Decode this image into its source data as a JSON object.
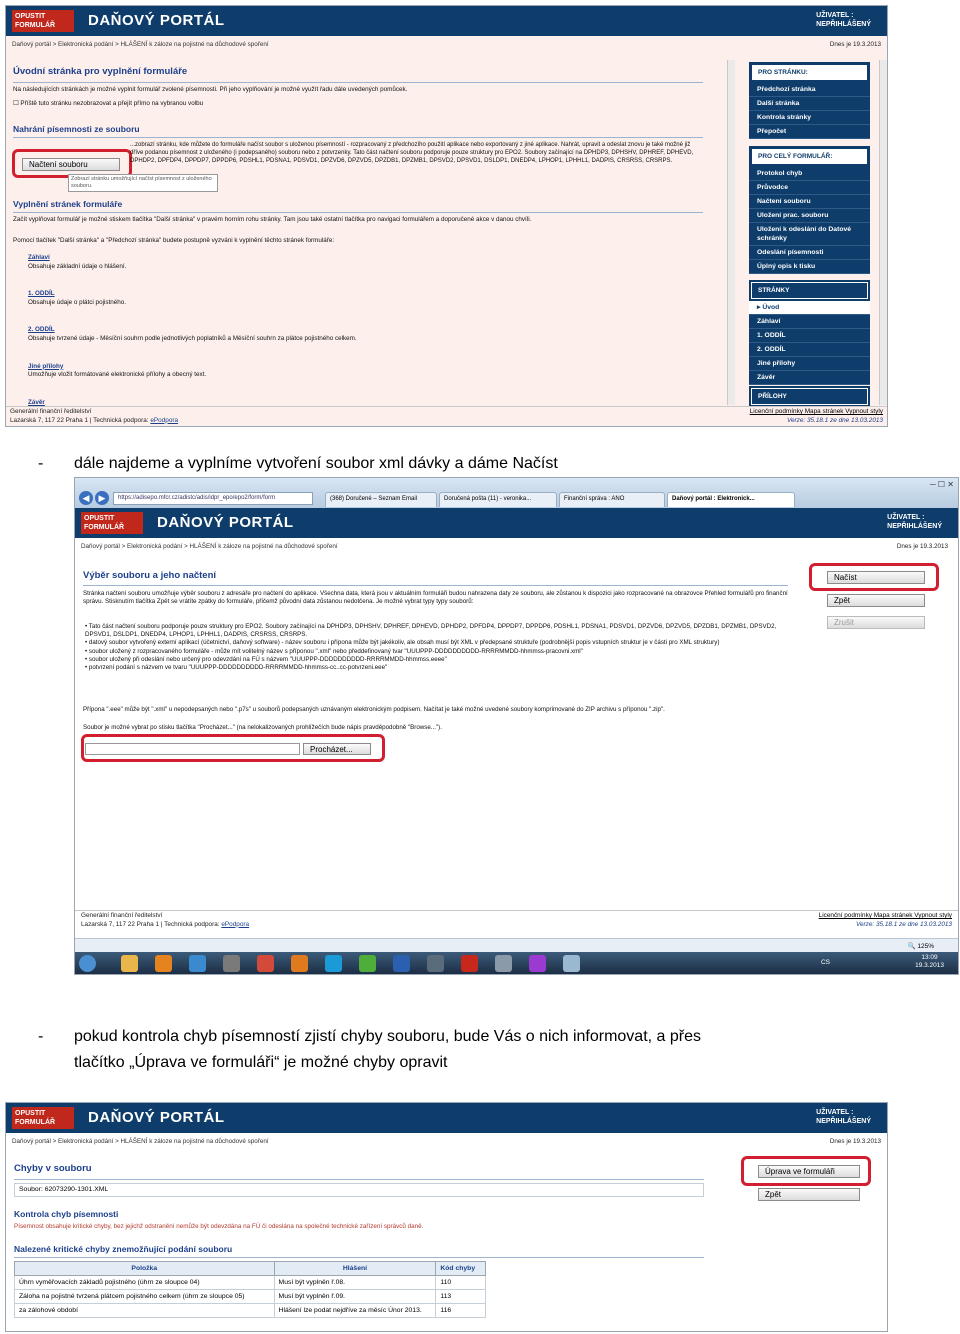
{
  "portal": {
    "logo_line1": "OPUSTIT",
    "logo_line2": "FORMULÁŘ",
    "title": "DAŇOVÝ PORTÁL",
    "user_line1": "UŽIVATEL :",
    "user_line2": "NEPŘIHLÁŠENÝ",
    "date": "Dnes je 19.3.2013",
    "breadcrumb": "Daňový portál > Elektronická podání > HLÁŠENÍ k záloze na pojistné na důchodové spoření",
    "footer_line1": "Generální finanční ředitelství",
    "footer_line2": "Lazarská 7, 117 22 Praha 1 | Technická podpora: ",
    "footer_link": "ePodpora",
    "footer_links": "Licenční podmínky  Mapa stránek  Vypnout styly",
    "version": "Verze: 35.18.1 ze dne 13.03.2013"
  },
  "shot1": {
    "heading": "Úvodní stránka pro vyplnění formuláře",
    "intro": "Na následujících stránkách je možné vyplnit formulář zvolené písemnosti. Při jeho vyplňování je možné využít řadu dále uvedených pomůcek.",
    "checkbox_label": "Příště tuto stránku nezobrazovat a přejít přímo na vybranou volbu",
    "section1": "Nahrání písemnosti ze souboru",
    "load_button": "Načtení souboru",
    "tooltip": "Zobrazí stránku umožňující načíst písemnost z uloženého souboru.",
    "section1_text": "...zobrazí stránku, kde můžete do formuláře načíst soubor s uloženou písemností - rozpracovaný z předchozího použití aplikace nebo exportovaný z jiné aplikace. Nahrát, upravit a odeslat znovu je také možné již dříve podanou písemnost z uloženého (i podepsaného) souboru nebo z potvrzenky. Tato část načtení souboru podporuje pouze struktury pro EPO2. Soubory začínající na DPHDP3, DPHSHV, DPHREF, DPHEVD, DPHDP2, DPFDP4, DPPDP7, DPPDP6, PDSHL1, PDSNA1, PDSVD1, DPZVD6, DPZVD5, DPZDB1, DPZMB1, DPSVD2, DPSVD1, DSLDP1, DNEDP4, LPHOP1, LPHHL1, DADPIS, CRSRSS, CRSRPS.",
    "section2": "Vyplnění stránek formuláře",
    "section2_text": "Začít vyplňovat formulář je možné stiskem tlačítka \"Další stránka\" v pravém horním rohu stránky. Tam jsou také ostatní tlačítka pro navigaci formulářem a doporučené akce v danou chvíli.",
    "section2_text2": "Pomocí tlačítek \"Další stránka\" a \"Předchozí stránka\" budete postupně vyzváni k vyplnění těchto stránek formuláře:",
    "pages": [
      {
        "title": "Záhlaví",
        "desc": "Obsahuje základní údaje o hlášení."
      },
      {
        "title": "1. ODDÍL",
        "desc": "Obsahuje údaje o plátci pojistného."
      },
      {
        "title": "2. ODDÍL",
        "desc": "Obsahuje tvrzené údaje - Měsíční souhrn podle jednotlivých poplatníků a Měsíční souhrn za plátce pojistného celkem."
      },
      {
        "title": "Jiné přílohy",
        "desc": "Umožňuje vložit formátované elektronické přílohy a obecný text."
      },
      {
        "title": "Závěr",
        "desc": ""
      }
    ],
    "sidebar": [
      {
        "head": "PRO STRÁNKU:",
        "items": [
          "Předchozí stránka",
          "Další stránka",
          "Kontrola stránky",
          "Přepočet"
        ]
      },
      {
        "head": "PRO CELÝ FORMULÁŘ:",
        "items": [
          "Protokol chyb",
          "Průvodce",
          "Načtení souboru",
          "Uložení prac. souboru",
          "Uložení k odeslání do Datové schránky",
          "Odeslání písemnosti",
          "Úplný opis k tisku"
        ]
      },
      {
        "head": "STRÁNKY",
        "items": [
          "Úvod",
          "Záhlaví",
          "1. ODDÍL",
          "2. ODDÍL",
          "Jiné přílohy",
          "Závěr"
        ]
      },
      {
        "head": "PŘÍLOHY",
        "items": []
      }
    ]
  },
  "text_between_1": {
    "dash": "-",
    "text": "dále najdeme a vyplníme vytvoření soubor xml dávky a dáme Načíst"
  },
  "shot2": {
    "browser_url": "https://adisepo.mfcr.cz/adistc/adis/idpr_epo/epo2/form/form",
    "tabs": [
      "(368) Doručené – Seznam Email",
      "Doručená pošta (11) - veronika...",
      "Finanční správa : ANO",
      "Daňový portál : Elektronick..."
    ],
    "heading": "Výběr souboru a jeho načtení",
    "intro": "Stránka načtení souboru umožňuje výběr souboru z adresáře pro načtení do aplikace. Všechna data, která jsou v aktuálním formuláři budou nahrazena daty ze souboru, ale zůstanou k dispozici jako rozpracované na obrazovce Přehled formulářů pro finanční správu. Stisknutím tlačítka Zpět se vrátíte zpátky do formuláře, přičemž původní data zůstanou nedotčena. Je možné vybrat typy typy souborů:",
    "bullets": [
      "Tato část načtení souboru podporuje pouze struktury pro EPO2. Soubory začínající na DPHDP3, DPHSHV, DPHREF, DPHEVD, DPHDP2, DPFDP4, DPPDP7, DPPDP6, PDSHL1, PDSNA1, PDSVD1, DPZVD6, DPZVD5, DPZDB1, DPZMB1, DPSVD2, DPSVD1, DSLDP1, DNEDP4, LPHOP1, LPHHL1, DADPIS, CRSRSS, CRSRPS.",
      "datový soubor vytvořený externí aplikací (účetnictví, daňový software) - název souboru i přípona může být jakékoliv, ale obsah musí být XML v předepsané struktuře (podrobnější popis vstupních struktur je v části pro XML struktury)",
      "soubor uložený z rozpracovaného formuláře - může mít volitelný název s příponou \".xml\" nebo předdefinovaný tvar \"UUUPPP-DDDDDDDDDD-RRRRMMDD-hhmmss-pracovni.xml\"",
      "soubor uložený při odeslání nebo určený pro odevzdání na FÚ s názvem \"UUUPPP-DDDDDDDDDD-RRRRMMDD-hhmmss.eeee\"",
      "potvrzení podání s názvem ve tvaru \"UUUPPP-DDDDDDDDDD-RRRRMMDD-hhmmss-cc..cc-potvrzeni.eee\""
    ],
    "note": "Přípona \".eee\" může být \".xml\" u nepodepsaných nebo \".p7s\" u souborů podepsaných uznávaným elektronickým podpisem. Načítat je také možné uvedené soubory komprimované do ZIP archivu s příponou \".zip\".",
    "note2": "Soubor je možné vybrat po stisku tlačítka \"Procházet...\" (na nelokalizovaných prohlížečích bude nápis pravděpodobně \"Browse...\").",
    "browse_button": "Procházet...",
    "buttons": [
      "Načíst",
      "Zpět",
      "Zrušit"
    ],
    "zoom": "125%",
    "clock_time": "13:09",
    "clock_date": "19.3.2013",
    "lang": "CS"
  },
  "text_between_2": {
    "dash": "-",
    "line1": "pokud kontrola chyb písemností zjistí chyby souboru, bude Vás o nich informovat, a přes",
    "line2": "tlačítko „Úprava ve formuláři“ je možné chyby opravit"
  },
  "shot3": {
    "heading": "Chyby v souboru",
    "file_label": "Soubor: 62073290-1301.XML",
    "buttons": [
      "Úprava ve formuláři",
      "Zpět"
    ],
    "control_heading": "Kontrola chyb písemnosti",
    "control_text": "Písemnost obsahuje kritické chyby, bez jejichž odstranění nemůže být odevzdána na FÚ či odeslána na společné technické zařízení správců daně.",
    "table_heading": "Nalezené kritické chyby znemožňující podání souboru",
    "columns": [
      "Položka",
      "Hlášení",
      "Kód chyby"
    ],
    "rows": [
      [
        "Úhrn vyměřovacích základů pojistného (úhrn ze sloupce 04)",
        "Musí být vyplněn ř.08.",
        "110"
      ],
      [
        "Záloha na pojistné tvrzená plátcem pojistného celkem (úhrn ze sloupce 05)",
        "Musí být vyplněn ř.09.",
        "113"
      ],
      [
        "za zálohové období",
        "Hlášení lze podat nejdříve za měsíc Únor 2013.",
        "116"
      ]
    ]
  }
}
